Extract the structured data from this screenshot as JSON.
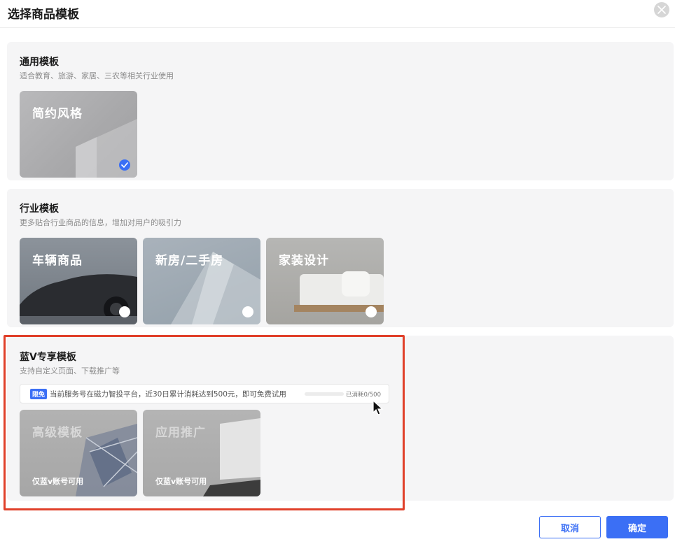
{
  "dialog": {
    "title": "选择商品模板"
  },
  "sections": {
    "general": {
      "title": "通用模板",
      "desc": "适合教育、旅游、家居、三农等相关行业使用",
      "cards": [
        {
          "label": "简约风格",
          "selected": true
        }
      ]
    },
    "industry": {
      "title": "行业模板",
      "desc": "更多贴合行业商品的信息，增加对用户的吸引力",
      "cards": [
        {
          "label": "车辆商品",
          "selected": false
        },
        {
          "label": "新房/二手房",
          "selected": false
        },
        {
          "label": "家装设计",
          "selected": false
        }
      ]
    },
    "bluev": {
      "title": "蓝V专享模板",
      "desc": "支持自定义页面、下载推广等",
      "notice": {
        "badge": "限免",
        "text": "当前服务号在磁力智投平台，近30日累计消耗达到500元，即可免费试用",
        "progress_text": "已消耗0/500",
        "progress_value": 0
      },
      "cards": [
        {
          "label": "高级模板",
          "note": "仅蓝v账号可用"
        },
        {
          "label": "应用推广",
          "note": "仅蓝v账号可用"
        }
      ]
    }
  },
  "footer": {
    "cancel_label": "取消",
    "ok_label": "确定"
  },
  "colors": {
    "accent": "#3b6ff5",
    "highlight": "#e0402a",
    "section_bg": "#f5f5f6"
  }
}
